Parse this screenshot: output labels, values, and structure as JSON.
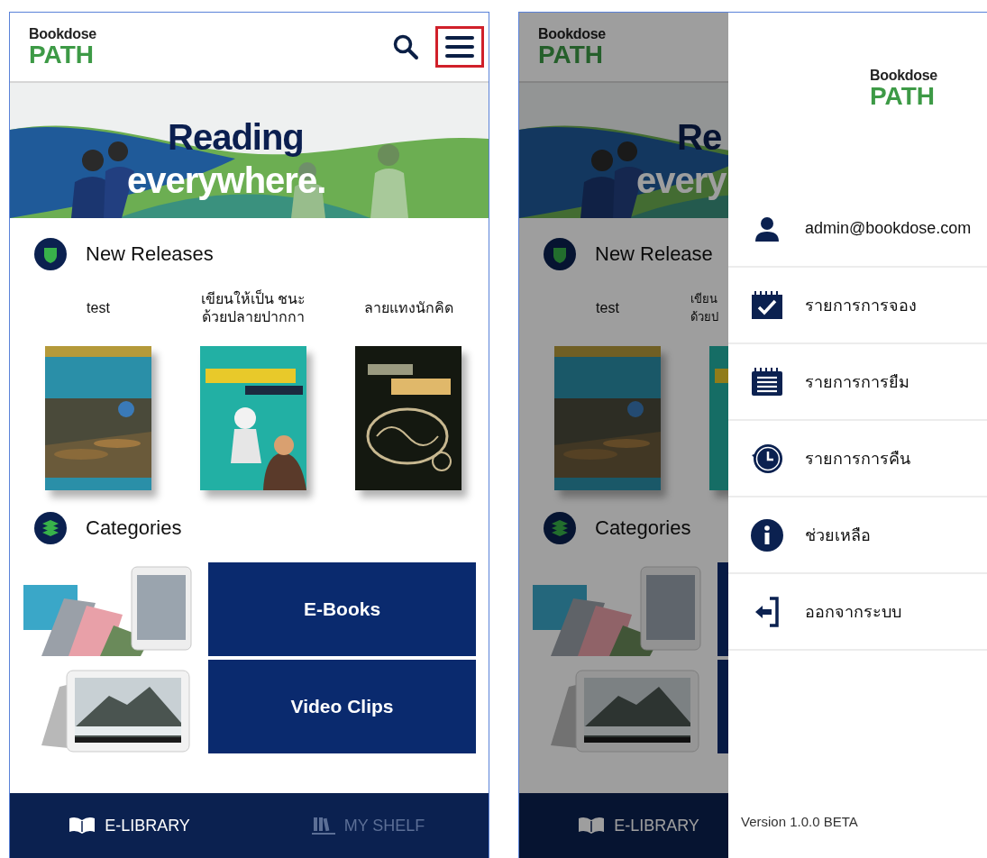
{
  "screens": [
    {
      "dimmed": false,
      "logo": {
        "top": "Bookdose",
        "bottom": "PATH"
      },
      "header_icons": [
        {
          "kind": "search",
          "highlighted": false
        },
        {
          "kind": "menu",
          "highlighted": true
        }
      ],
      "hero_lines": [
        "Reading",
        "everywhere."
      ],
      "releases": {
        "title": "New Releases",
        "books": [
          {
            "title": "test"
          },
          {
            "title": "เขียนให้เป็น ชนะ\nด้วยปลายปากกา"
          },
          {
            "title": "ลายแทงนักคิด"
          }
        ]
      },
      "categories": {
        "title": "Categories",
        "tiles": [
          {
            "kind": "ebooks",
            "label": "E-Books"
          },
          {
            "kind": "video",
            "label": "Video Clips"
          }
        ]
      },
      "nav": [
        {
          "kind": "library",
          "label": "E-LIBRARY",
          "selected": true
        },
        {
          "kind": "shelf",
          "label": "MY SHELF",
          "selected": false
        }
      ]
    },
    {
      "dimmed": true,
      "logo": {
        "top": "Bookdose",
        "bottom": "PATH"
      },
      "hero_lines": [
        "Re",
        "every"
      ],
      "releases": {
        "title": "New Release",
        "books": [
          {
            "title": "test"
          },
          {
            "title": "เขียน\nด้วยป"
          }
        ]
      },
      "categories": {
        "title": "Categories",
        "tiles": [
          {
            "kind": "ebooks"
          },
          {
            "kind": "video"
          }
        ]
      },
      "nav": [
        {
          "kind": "library",
          "label": "E-LIBRARY",
          "selected": true
        }
      ],
      "drawer": {
        "logo": {
          "top": "Bookdose",
          "bottom": "PATH"
        },
        "items": [
          {
            "kind": "user",
            "label": "admin@bookdose.com"
          },
          {
            "kind": "booking",
            "label": "รายการการจอง"
          },
          {
            "kind": "borrow",
            "label": "รายการการยืม"
          },
          {
            "kind": "return",
            "label": "รายการการคืน"
          },
          {
            "kind": "help",
            "label": "ช่วยเหลือ"
          },
          {
            "kind": "logout",
            "label": "ออกจากระบบ"
          }
        ],
        "version": "Version 1.0.0 BETA"
      }
    }
  ]
}
